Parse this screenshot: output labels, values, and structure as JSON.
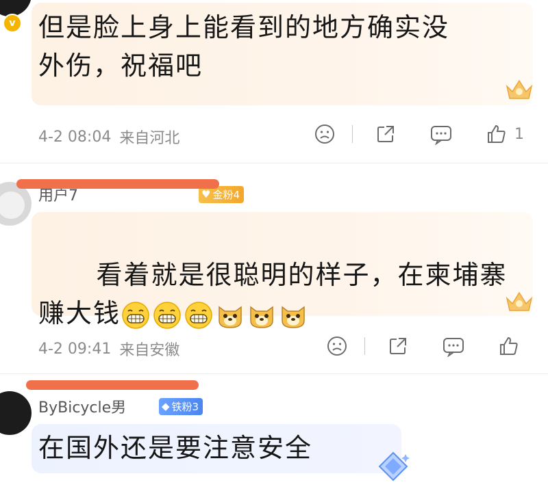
{
  "comments": [
    {
      "text": "但是脸上身上能看到的地方确实没\n外伤，祝福吧",
      "time": "4-2 08:04",
      "location": "来自河北",
      "like_count": "1",
      "verified_icon": "verified-v-icon"
    },
    {
      "username": "用户7",
      "fan_badge": "金粉4",
      "text": "看着就是很聪明的样子，在柬埔寨\n赚大钱",
      "emojis": [
        "grin-emoji",
        "grin-emoji",
        "grin-emoji",
        "doge-emoji",
        "doge-emoji",
        "doge-emoji"
      ],
      "time": "4-2 09:41",
      "location": "来自安徽"
    },
    {
      "username": "ByBicycle男",
      "fan_badge": "铁粉3",
      "text": "在国外还是要注意安全"
    }
  ],
  "icons": {
    "dislike": "frown-icon",
    "share": "share-icon",
    "comment": "comment-icon",
    "like": "thumbs-up-icon"
  },
  "colors": {
    "gold_badge": "#f3a72a",
    "iron_badge": "#4a86f0",
    "redaction": "#f0704c"
  }
}
